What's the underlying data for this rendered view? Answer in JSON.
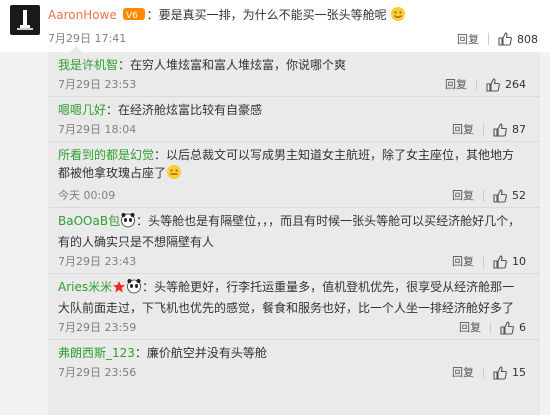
{
  "main_comment": {
    "username": "AaronHowe",
    "text": "：要是真买一排，为什么不能买一张头等舱呢",
    "time": "7月29日 17:41",
    "reply_label": "回复",
    "likes": "808"
  },
  "replies": [
    {
      "username": "我是许机智",
      "text": "：在穷人堆炫富和富人堆炫富，你说哪个爽",
      "time": "7月29日 23:53",
      "reply_label": "回复",
      "likes": "264"
    },
    {
      "username": "嗯嗯几好",
      "text": "：在经济舱炫富比较有自豪感",
      "time": "7月29日 18:04",
      "reply_label": "回复",
      "likes": "87"
    },
    {
      "username": "所看到的都是幻觉",
      "text": "：以后总裁文可以写成男主知道女主航班，除了女主座位，其他地方都被他拿玫瑰占座了",
      "time": "今天 00:09",
      "reply_label": "回复",
      "likes": "52"
    },
    {
      "username": "BaOOaB包",
      "text": "：头等舱也是有隔壁位，，，而且有时候一张头等舱可以买经济舱好几个，有的人确实只是不想隔壁有人",
      "time": "7月29日 23:43",
      "reply_label": "回复",
      "likes": "10"
    },
    {
      "username": "Aries米米",
      "text": "：头等舱更好，行李托运重量多，值机登机优先，很享受从经济舱那一大队前面走过，下飞机也优先的感觉，餐食和服务也好，比一个人坐一排经济舱好多了",
      "time": "7月29日 23:59",
      "reply_label": "回复",
      "likes": "6"
    },
    {
      "username": "弗朗西斯_123",
      "text": "：廉价航空并没有头等舱",
      "time": "7月29日 23:56",
      "reply_label": "回复",
      "likes": "15"
    }
  ],
  "colors": {
    "username_main": "#eb7350",
    "username_reply": "#2e9e2e",
    "background": "#f2f2f2",
    "reply_bg": "#eaeaea"
  },
  "icons": [
    "avatar-icon",
    "vip-badge-icon",
    "smile-emoji-icon",
    "thumbs-up-icon",
    "star-badge-icon",
    "panda-emoji-icon"
  ]
}
